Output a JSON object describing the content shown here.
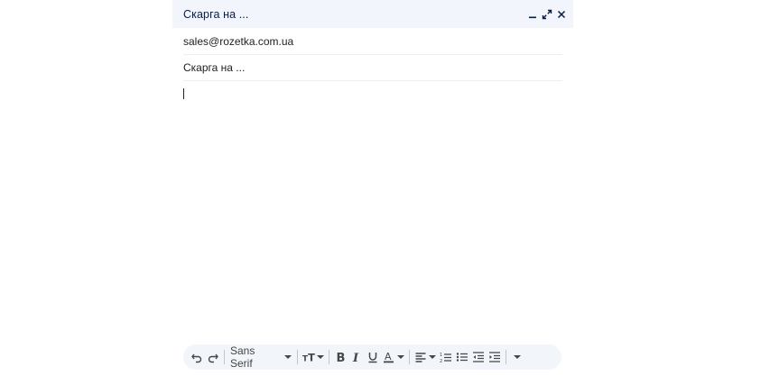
{
  "compose": {
    "title": "Скарга на ...",
    "to": "sales@rozetka.com.ua",
    "subject": "Скарга на ...",
    "body": ""
  },
  "header_icons": [
    "minimize-icon",
    "expand-icon",
    "close-icon"
  ],
  "toolbar": {
    "font_family": "Sans Serif",
    "icons": [
      "undo-icon",
      "redo-icon",
      "font-size-icon",
      "bold-icon",
      "italic-icon",
      "underline-icon",
      "text-color-icon",
      "align-icon",
      "numbered-list-icon",
      "bulleted-list-icon",
      "indent-less-icon",
      "indent-more-icon",
      "more-formatting-icon"
    ]
  },
  "colors": {
    "header_bg": "#f2f6fc",
    "title_color": "#041e49",
    "toolbar_bg": "#f2f5fa",
    "icon_color": "#444746"
  }
}
